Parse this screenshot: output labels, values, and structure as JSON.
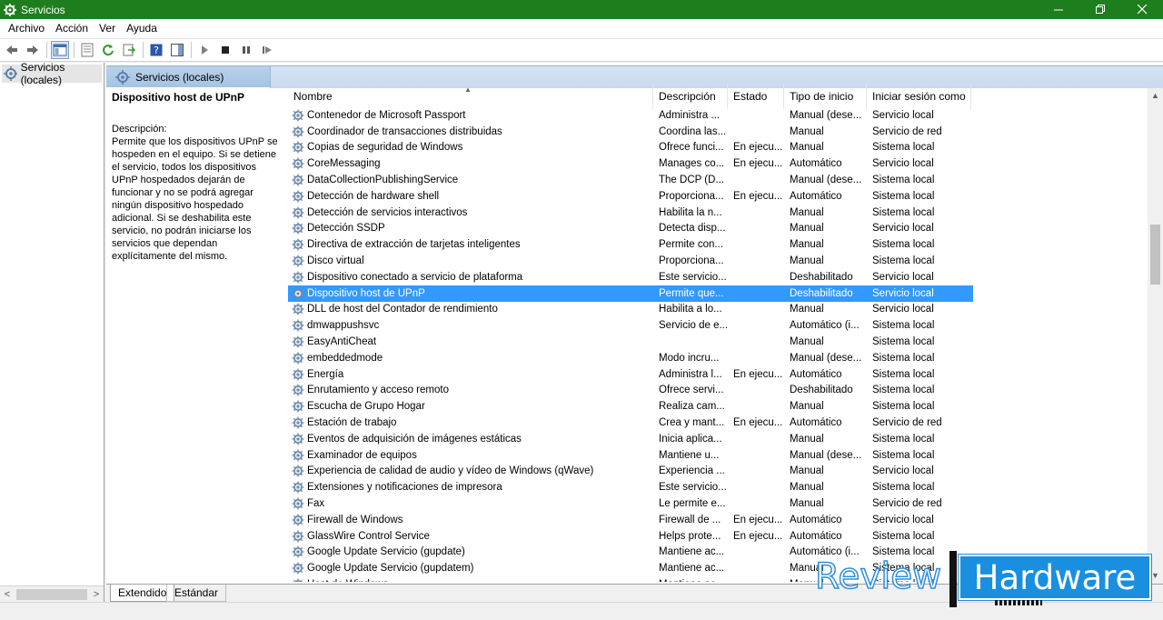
{
  "window": {
    "title": "Servicios",
    "controls": [
      "minimize",
      "restore",
      "close"
    ]
  },
  "menu": [
    "Archivo",
    "Acción",
    "Ver",
    "Ayuda"
  ],
  "toolbar": {
    "icons": [
      "back-arrow-icon",
      "forward-arrow-icon",
      "show-hide-console-tree-icon",
      "properties-icon",
      "refresh-icon",
      "export-list-icon",
      "help-icon",
      "show-action-pane-icon",
      "start-service-icon",
      "stop-service-icon",
      "pause-service-icon",
      "restart-service-icon"
    ]
  },
  "tree": {
    "root_label": "Servicios (locales)"
  },
  "pane_header": {
    "label": "Servicios (locales)"
  },
  "detail": {
    "title": "Dispositivo host de UPnP",
    "description_label": "Descripción:",
    "description_lines": [
      "Permite que los dispositivos UPnP se",
      "hospeden en el equipo. Si se detiene",
      "el servicio, todos los dispositivos",
      "UPnP hospedados dejarán de",
      "funcionar y no se podrá agregar",
      "ningún dispositivo hospedado",
      "adicional. Si se deshabilita este",
      "servicio, no podrán iniciarse los",
      "servicios que dependan",
      "explícitamente del mismo."
    ]
  },
  "columns": [
    "Nombre",
    "Descripción",
    "Estado",
    "Tipo de inicio",
    "Iniciar sesión como"
  ],
  "rows": [
    {
      "name": "Contenedor de Microsoft Passport",
      "desc": "Administra ...",
      "state": "",
      "start": "Manual (dese...",
      "logon": "Servicio local"
    },
    {
      "name": "Coordinador de transacciones distribuidas",
      "desc": "Coordina las...",
      "state": "",
      "start": "Manual",
      "logon": "Servicio de red"
    },
    {
      "name": "Copias de seguridad de Windows",
      "desc": "Ofrece funci...",
      "state": "En ejecu...",
      "start": "Manual",
      "logon": "Sistema local"
    },
    {
      "name": "CoreMessaging",
      "desc": "Manages co...",
      "state": "En ejecu...",
      "start": "Automático",
      "logon": "Servicio local"
    },
    {
      "name": "DataCollectionPublishingService",
      "desc": "The DCP (D...",
      "state": "",
      "start": "Manual (dese...",
      "logon": "Sistema local"
    },
    {
      "name": "Detección de hardware shell",
      "desc": "Proporciona...",
      "state": "En ejecu...",
      "start": "Automático",
      "logon": "Sistema local"
    },
    {
      "name": "Detección de servicios interactivos",
      "desc": "Habilita la n...",
      "state": "",
      "start": "Manual",
      "logon": "Sistema local"
    },
    {
      "name": "Detección SSDP",
      "desc": "Detecta disp...",
      "state": "",
      "start": "Manual",
      "logon": "Servicio local"
    },
    {
      "name": "Directiva de extracción de tarjetas inteligentes",
      "desc": "Permite con...",
      "state": "",
      "start": "Manual",
      "logon": "Sistema local"
    },
    {
      "name": "Disco virtual",
      "desc": "Proporciona...",
      "state": "",
      "start": "Manual",
      "logon": "Sistema local"
    },
    {
      "name": "Dispositivo conectado a servicio de plataforma",
      "desc": "Este servicio...",
      "state": "",
      "start": "Deshabilitado",
      "logon": "Servicio local"
    },
    {
      "name": "Dispositivo host de UPnP",
      "desc": "Permite que...",
      "state": "",
      "start": "Deshabilitado",
      "logon": "Servicio local",
      "selected": true
    },
    {
      "name": "DLL de host del Contador de rendimiento",
      "desc": "Habilita a lo...",
      "state": "",
      "start": "Manual",
      "logon": "Servicio local"
    },
    {
      "name": "dmwappushsvc",
      "desc": "Servicio de e...",
      "state": "",
      "start": "Automático (i...",
      "logon": "Sistema local"
    },
    {
      "name": "EasyAntiCheat",
      "desc": "",
      "state": "",
      "start": "Manual",
      "logon": "Sistema local"
    },
    {
      "name": "embeddedmode",
      "desc": "Modo incru...",
      "state": "",
      "start": "Manual (dese...",
      "logon": "Sistema local"
    },
    {
      "name": "Energía",
      "desc": "Administra l...",
      "state": "En ejecu...",
      "start": "Automático",
      "logon": "Sistema local"
    },
    {
      "name": "Enrutamiento y acceso remoto",
      "desc": "Ofrece servi...",
      "state": "",
      "start": "Deshabilitado",
      "logon": "Sistema local"
    },
    {
      "name": "Escucha de Grupo Hogar",
      "desc": "Realiza cam...",
      "state": "",
      "start": "Manual",
      "logon": "Sistema local"
    },
    {
      "name": "Estación de trabajo",
      "desc": "Crea y mant...",
      "state": "En ejecu...",
      "start": "Automático",
      "logon": "Servicio de red"
    },
    {
      "name": "Eventos de adquisición de imágenes estáticas",
      "desc": "Inicia aplica...",
      "state": "",
      "start": "Manual",
      "logon": "Sistema local"
    },
    {
      "name": "Examinador de equipos",
      "desc": "Mantiene u...",
      "state": "",
      "start": "Manual (dese...",
      "logon": "Sistema local"
    },
    {
      "name": "Experiencia de calidad de audio y vídeo de Windows (qWave)",
      "desc": "Experiencia ...",
      "state": "",
      "start": "Manual",
      "logon": "Servicio local"
    },
    {
      "name": "Extensiones y notificaciones de impresora",
      "desc": "Este servicio...",
      "state": "",
      "start": "Manual",
      "logon": "Sistema local"
    },
    {
      "name": "Fax",
      "desc": "Le permite e...",
      "state": "",
      "start": "Manual",
      "logon": "Servicio de red"
    },
    {
      "name": "Firewall de Windows",
      "desc": "Firewall de ...",
      "state": "En ejecu...",
      "start": "Automático",
      "logon": "Servicio local"
    },
    {
      "name": "GlassWire Control Service",
      "desc": "Helps prote...",
      "state": "En ejecu...",
      "start": "Automático",
      "logon": "Sistema local"
    },
    {
      "name": "Google Update Servicio (gupdate)",
      "desc": "Mantiene ac...",
      "state": "",
      "start": "Automático (i...",
      "logon": "Sistema local"
    },
    {
      "name": "Google Update Servicio (gupdatem)",
      "desc": "Mantiene ac...",
      "state": "",
      "start": "Manual",
      "logon": "Sistema local"
    },
    {
      "name": "Host de Windows...",
      "desc": "Mantiene ac...",
      "state": "",
      "start": "Manual",
      "logon": "Sistema local"
    }
  ],
  "bottom_tabs": [
    "Extendido",
    "Estándar"
  ],
  "watermark": {
    "left": "Review",
    "right": "Hardware"
  },
  "colors": {
    "titlebar": "#1e7e1e",
    "selection": "#3399ff",
    "watermark_blue": "#1a8fe0"
  }
}
